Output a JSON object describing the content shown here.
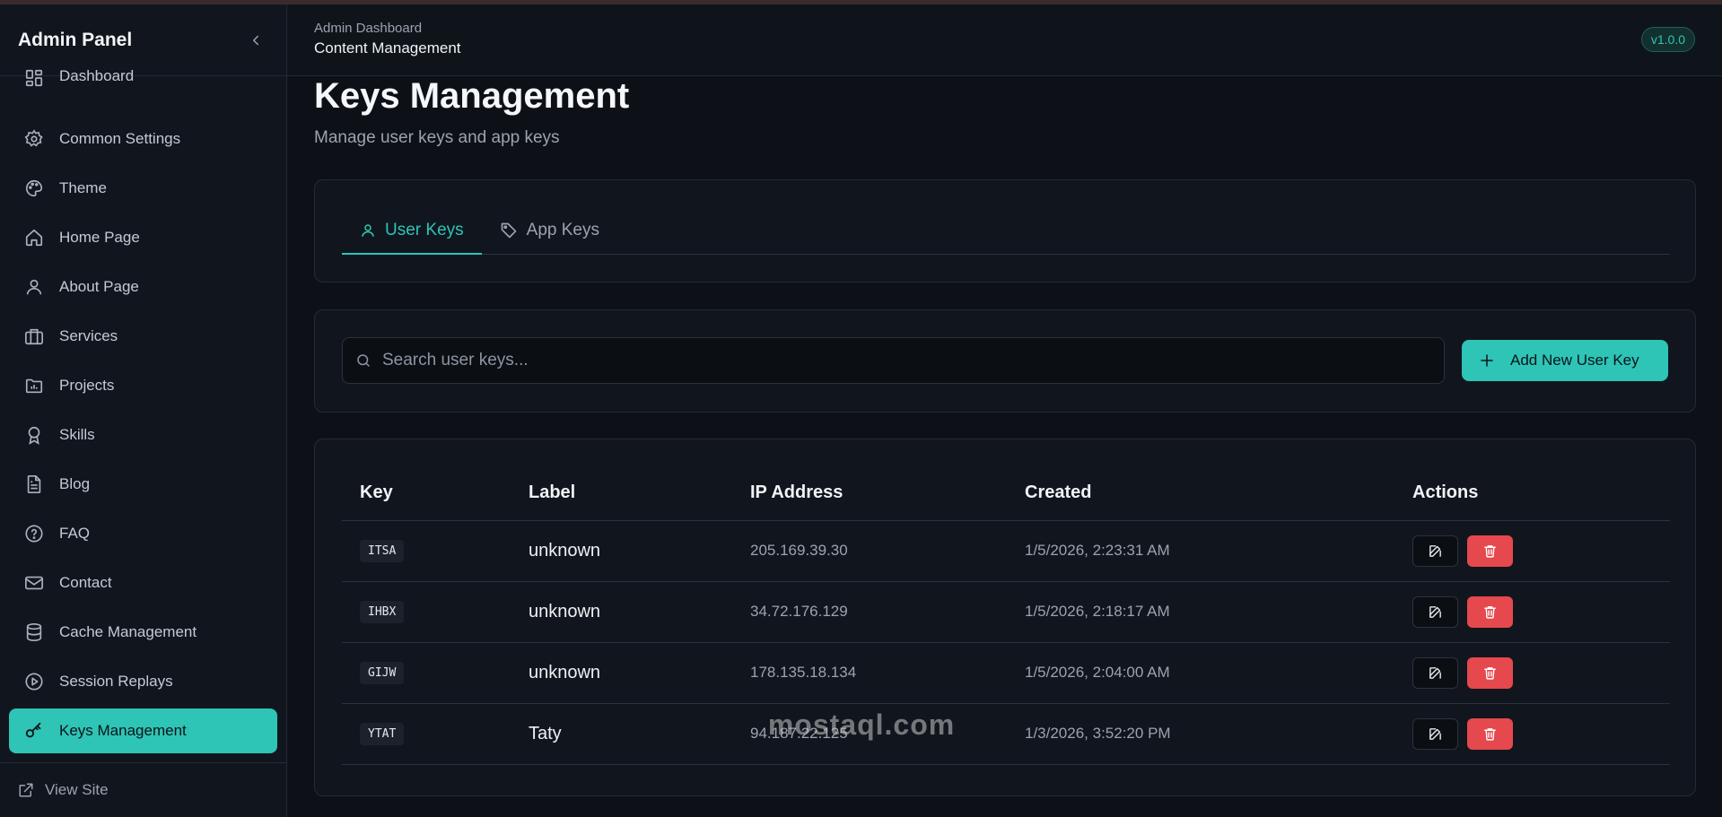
{
  "app": {
    "title": "Admin Panel",
    "version": "v1.0.0"
  },
  "header": {
    "breadcrumb": "Admin Dashboard",
    "section": "Content Management"
  },
  "sidebar": {
    "items": [
      {
        "label": "Dashboard",
        "icon": "dashboard-icon"
      },
      {
        "label": "Common Settings",
        "icon": "gear-icon"
      },
      {
        "label": "Theme",
        "icon": "palette-icon"
      },
      {
        "label": "Home Page",
        "icon": "home-icon"
      },
      {
        "label": "About Page",
        "icon": "user-icon"
      },
      {
        "label": "Services",
        "icon": "briefcase-icon"
      },
      {
        "label": "Projects",
        "icon": "folder-chart-icon"
      },
      {
        "label": "Skills",
        "icon": "award-icon"
      },
      {
        "label": "Blog",
        "icon": "document-icon"
      },
      {
        "label": "FAQ",
        "icon": "help-circle-icon"
      },
      {
        "label": "Contact",
        "icon": "mail-icon"
      },
      {
        "label": "Cache Management",
        "icon": "database-icon"
      },
      {
        "label": "Session Replays",
        "icon": "play-circle-icon"
      },
      {
        "label": "Keys Management",
        "icon": "key-icon",
        "active": true
      }
    ],
    "footer": {
      "label": "View Site",
      "icon": "external-link-icon"
    }
  },
  "main": {
    "title": "Keys Management",
    "subtitle": "Manage user keys and app keys",
    "tabs": [
      {
        "label": "User Keys",
        "icon": "user-icon",
        "active": true
      },
      {
        "label": "App Keys",
        "icon": "tag-icon",
        "active": false
      }
    ],
    "search": {
      "placeholder": "Search user keys...",
      "value": ""
    },
    "add_button": "Add New User Key",
    "table": {
      "columns": [
        "Key",
        "Label",
        "IP Address",
        "Created",
        "Actions"
      ],
      "rows": [
        {
          "key": "ITSA",
          "label": "unknown",
          "ip": "205.169.39.30",
          "created": "1/5/2026, 2:23:31 AM"
        },
        {
          "key": "IHBX",
          "label": "unknown",
          "ip": "34.72.176.129",
          "created": "1/5/2026, 2:18:17 AM"
        },
        {
          "key": "GIJW",
          "label": "unknown",
          "ip": "178.135.18.134",
          "created": "1/5/2026, 2:04:00 AM"
        },
        {
          "key": "YTAT",
          "label": "Taty",
          "ip": "94.187.22.125",
          "created": "1/3/2026, 3:52:20 PM"
        }
      ]
    }
  },
  "watermark": {
    "text": "mostaql.com"
  },
  "colors": {
    "accent": "#2ec4b6",
    "danger": "#e5484d",
    "background": "#0d1117",
    "panel": "#11161e"
  }
}
